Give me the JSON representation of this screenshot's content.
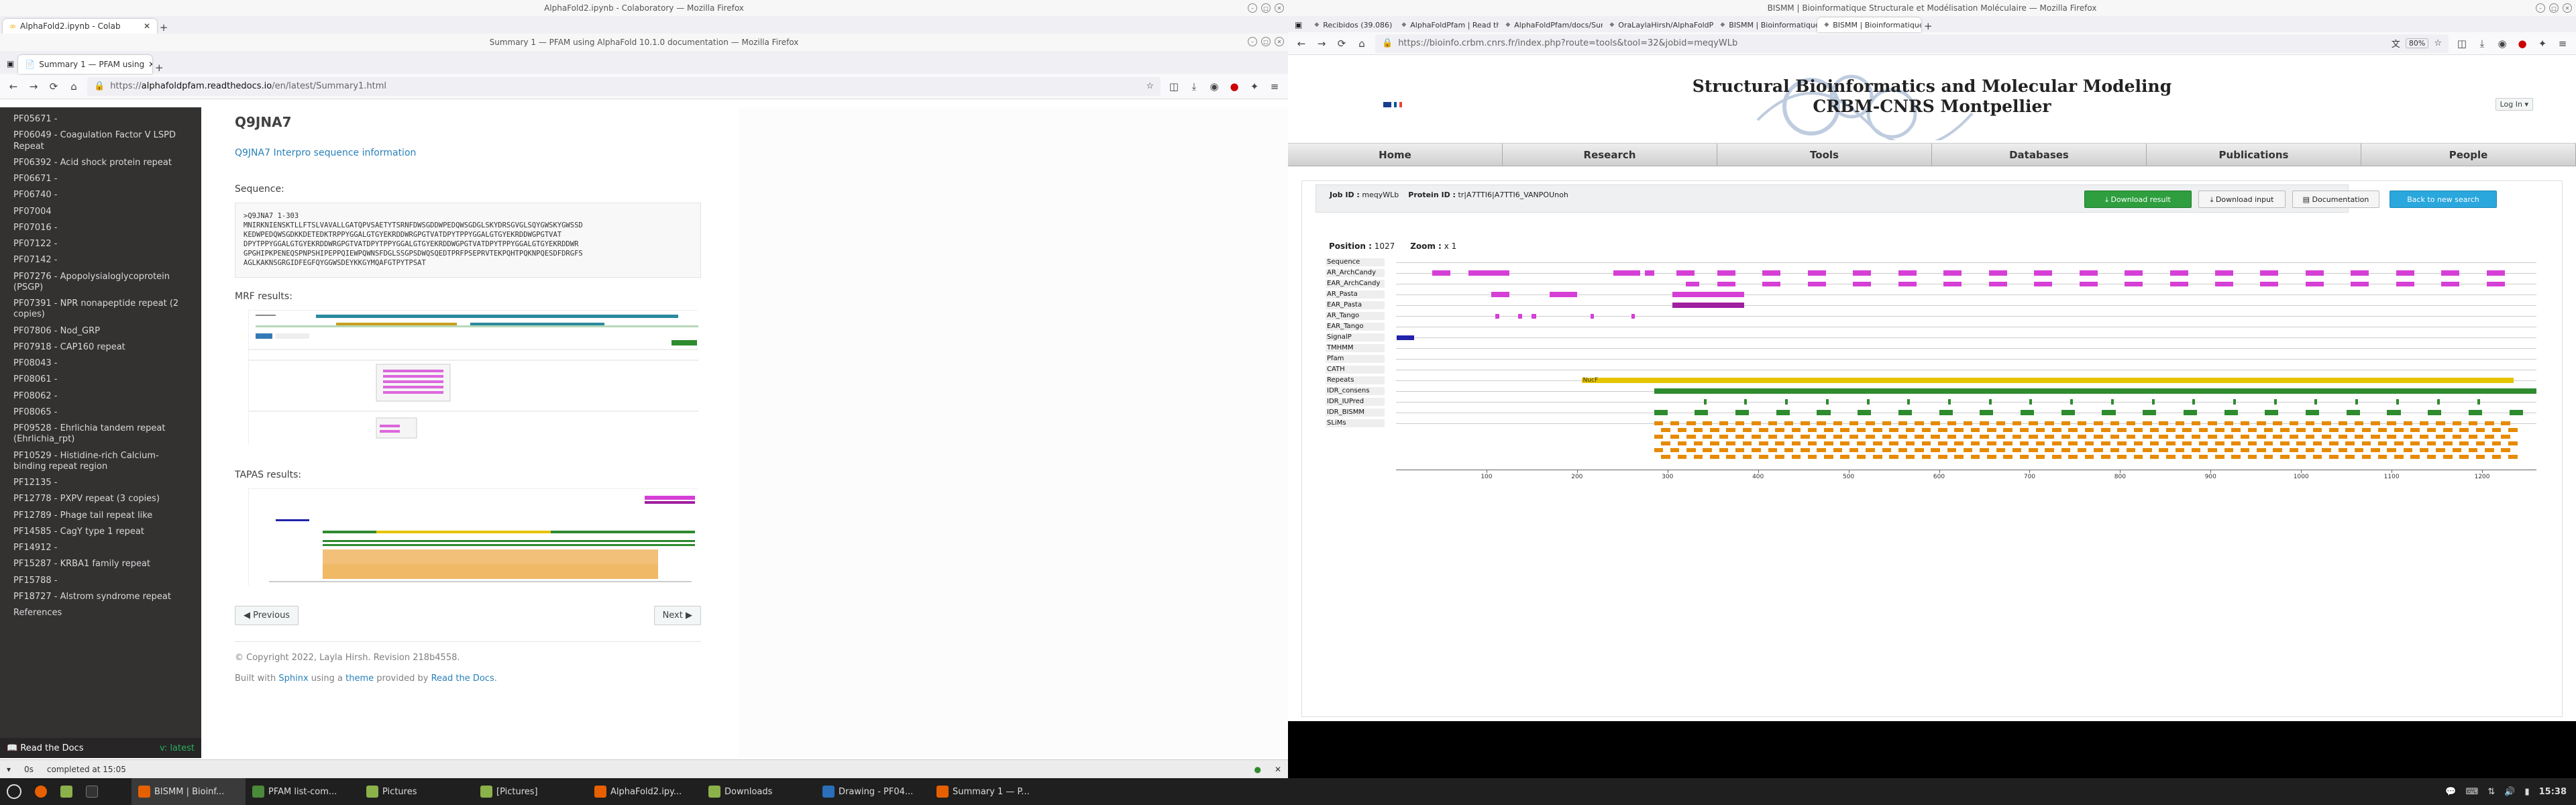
{
  "left_window": {
    "title": "Summary 1 — PFAM using AlphaFold 10.1.0 documentation — Mozilla Firefox",
    "top_title": "AlphaFold2.ipynb - Colaboratory — Mozilla Firefox",
    "top_tab": "AlphaFold2.ipynb - Colab",
    "tab": "Summary 1 — PFAM using",
    "url_host": "alphafoldpfam.readthedocs.io",
    "url_rest": "/en/latest/Summary1.html",
    "url_prefix": "https://",
    "sidebar": [
      "PF05671 -",
      "PF06049 - Coagulation Factor V LSPD Repeat",
      "PF06392 - Acid shock protein repeat",
      "PF06671 -",
      "PF06740 -",
      "PF07004",
      "PF07016 -",
      "PF07122 -",
      "PF07142 -",
      "PF07276 - Apopolysialoglycoprotein (PSGP)",
      "PF07391 - NPR nonapeptide repeat (2 copies)",
      "PF07806 - Nod_GRP",
      "PF07918 - CAP160 repeat",
      "PF08043 -",
      "PF08061 -",
      "PF08062 -",
      "PF08065 -",
      "PF09528 - Ehrlichia tandem repeat (Ehrlichia_rpt)",
      "PF10529 - Histidine-rich Calcium-binding repeat region",
      "PF12135 -",
      "PF12778 - PXPV repeat (3 copies)",
      "PF12789 - Phage tail repeat like",
      "PF14585 - CagY type 1 repeat",
      "PF14912 -",
      "PF15287 - KRBA1 family repeat",
      "PF15788 -",
      "PF18727 - Alstrom syndrome repeat",
      "References"
    ],
    "rtd_label": "Read the Docs",
    "rtd_version": "v: latest",
    "heading": "Q9JNA7",
    "interpro_link": "Q9JNA7 Interpro sequence information",
    "sequence_label": "Sequence:",
    "sequence": ">Q9JNA7 1-303\nMNIRKNIENSKTLLFTSLVAVALLGATQPVSAETYTSRNFDWSGDDWPEDQWSGDGLSKYDRSGVGLSQYGWSKYGWSSD\nKEDWPEDQWSGDKKDETEDKTRPPYGGALGTGYEKRDDWRGPGTVATDPYTPPYGGALGTGYEKRDDWGPGTVAT\nDPYTPPYGGALGTGYEKRDDWRGPGTVATDPYTPPYGGALGTGYEKRDDWGPGTVATDPYTPPYGGALGTGYEKRDDWR\nGPGHIPKPENEQSPNPSHIPEPPQIEWPQWNSFDGLSSGPSDWQSQEDTPRFPSEPRVTEKPQHTPQKNPQESDFDRGFS\nAGLKAKNSGRGIDFEGFQYGGWSDEYKKGYMQAFGTPYTPSAT",
    "mrf_label": "MRF results:",
    "tapas_label": "TAPAS results:",
    "prev": "Previous",
    "next": "Next",
    "copyright": "© Copyright 2022, Layla Hirsh. Revision 218b4558.",
    "built_with": "Built with",
    "sphinx": "Sphinx",
    "using_a": "using a",
    "theme": "theme",
    "provided_by": "provided by",
    "rtd_link": "Read the Docs",
    "status_time": "0s",
    "status_text": "completed at 15:05"
  },
  "right_window": {
    "title": "BISMM | Bioinformatique Structurale et Modélisation Moléculaire — Mozilla Firefox",
    "tabs": [
      "Recibidos (39.086) - lhirsh@",
      "AlphaFoldPfam | Read the D",
      "AlphaFoldPfam/docs/Sumr",
      "OraLaylaHirsh/AlphaFoldP",
      "BISMM | Bioinformatique S",
      "BISMM | Bioinformatique S"
    ],
    "url": "https://bioinfo.crbm.cnrs.fr/index.php?route=tools&tool=32&jobid=meqyWLb",
    "zoom": "80%",
    "site_title_1": "Structural Bioinformatics and Molecular Modeling",
    "site_title_2": "CRBM-CNRS Montpellier",
    "login": "Log In",
    "nav": [
      "Home",
      "Research",
      "Tools",
      "Databases",
      "Publications",
      "People"
    ],
    "job_id_label": "Job ID :",
    "job_id": "meqyWLb",
    "protein_id_label": "Protein ID :",
    "protein_id": "tr|A7TTI6|A7TTI6_VANPOUnoh",
    "buttons": {
      "download_result": "Download result",
      "download_input": "Download input",
      "documentation": "Documentation",
      "new_search": "Back to new search"
    },
    "position_label": "Position :",
    "position": "1027",
    "zoom_label": "Zoom :",
    "zoom_val": "x 1",
    "tracks": [
      "Sequence",
      "AR_ArchCandy",
      "EAR_ArchCandy",
      "AR_Pasta",
      "EAR_Pasta",
      "AR_Tango",
      "EAR_Tango",
      "SignalP",
      "TMHMM",
      "Pfam",
      "CATH",
      "Repeats",
      "IDR_consens",
      "IDR_IUPred",
      "IDR_BISMM",
      "SLiMs"
    ],
    "repeat_label": "NucF",
    "axis_ticks": [
      "100",
      "200",
      "300",
      "400",
      "500",
      "600",
      "700",
      "800",
      "900",
      "1000",
      "1100",
      "1200"
    ],
    "colors": {
      "magenta": "#d63fd6",
      "dark_magenta": "#a020a0",
      "yellow": "#e6c400",
      "green": "#2e8b2e",
      "orange": "#e68a00",
      "blue": "#2222aa"
    }
  },
  "taskbar": {
    "clock": "15:38",
    "items": [
      "BISMM | Bioinf...",
      "PFAM list-com...",
      "Pictures",
      "[Pictures]",
      "AlphaFold2.ipy...",
      "Downloads",
      "Drawing - PF04...",
      "Summary 1 — P..."
    ]
  }
}
